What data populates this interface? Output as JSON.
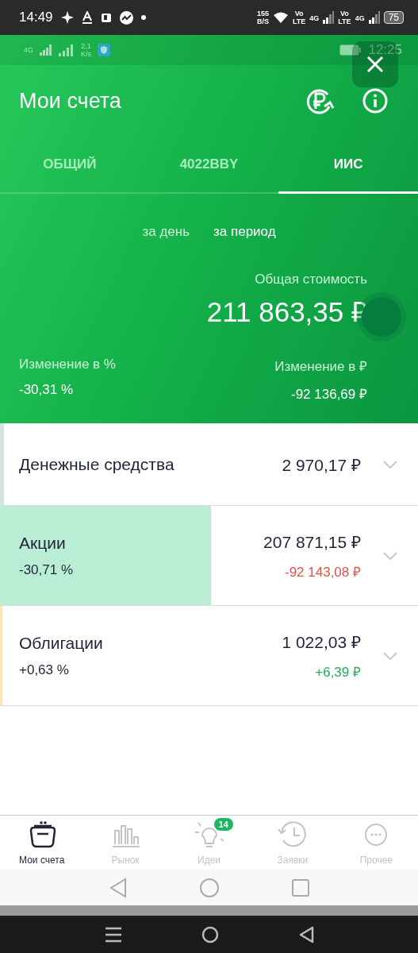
{
  "status_bar": {
    "time": "14:49",
    "speed": [
      "155",
      "B/S"
    ],
    "networks": [
      {
        "volte": [
          "Vo",
          "LTE"
        ],
        "type": "4G"
      },
      {
        "volte": [
          "Vo",
          "LTE"
        ],
        "type": "4G"
      }
    ],
    "battery": "75"
  },
  "inner_status_bar": {
    "network": "4G",
    "speed": [
      "2,1",
      "K/s"
    ],
    "time": "12:25"
  },
  "header": {
    "title": "Мои счета"
  },
  "tabs": [
    {
      "label": "ОБЩИЙ",
      "selected": false
    },
    {
      "label": "4022BBY",
      "selected": false
    },
    {
      "label": "ИИС",
      "selected": true
    }
  ],
  "periods": [
    {
      "label": "за день",
      "selected": false
    },
    {
      "label": "за период",
      "selected": true
    }
  ],
  "summary": {
    "total_label": "Общая стоимость",
    "total": "211 863,35 ₽",
    "change_percent_label": "Изменение в  %",
    "change_percent": "-30,31  %",
    "change_rub_label": "Изменение в ₽",
    "change_rub": "-92 136,69 ₽"
  },
  "assets": [
    {
      "name": "Денежные средства",
      "value": "2 970,17 ₽",
      "color": "#d3e3de",
      "level": 0.01
    },
    {
      "name": "Акции",
      "percent": "-30,71  %",
      "value": "207 871,15 ₽",
      "change": "-92 143,08 ₽",
      "kind": "loss",
      "color": "#b9eed5",
      "level": 0.505
    },
    {
      "name": "Облигации",
      "percent": "+0,63  %",
      "value": "1 022,03 ₽",
      "change": "+6,39 ₽",
      "kind": "gain",
      "color": "#fbe6b5",
      "level": 0.005
    }
  ],
  "bottom_nav": [
    {
      "label": "Мои счета",
      "kind": "wallet",
      "selected": true
    },
    {
      "label": "Рынок",
      "kind": "chart",
      "selected": false
    },
    {
      "label": "Идеи",
      "kind": "bulb",
      "selected": false,
      "badge": "14"
    },
    {
      "label": "Заявки",
      "kind": "history",
      "selected": false
    },
    {
      "label": "Прочее",
      "kind": "more",
      "selected": false
    }
  ]
}
